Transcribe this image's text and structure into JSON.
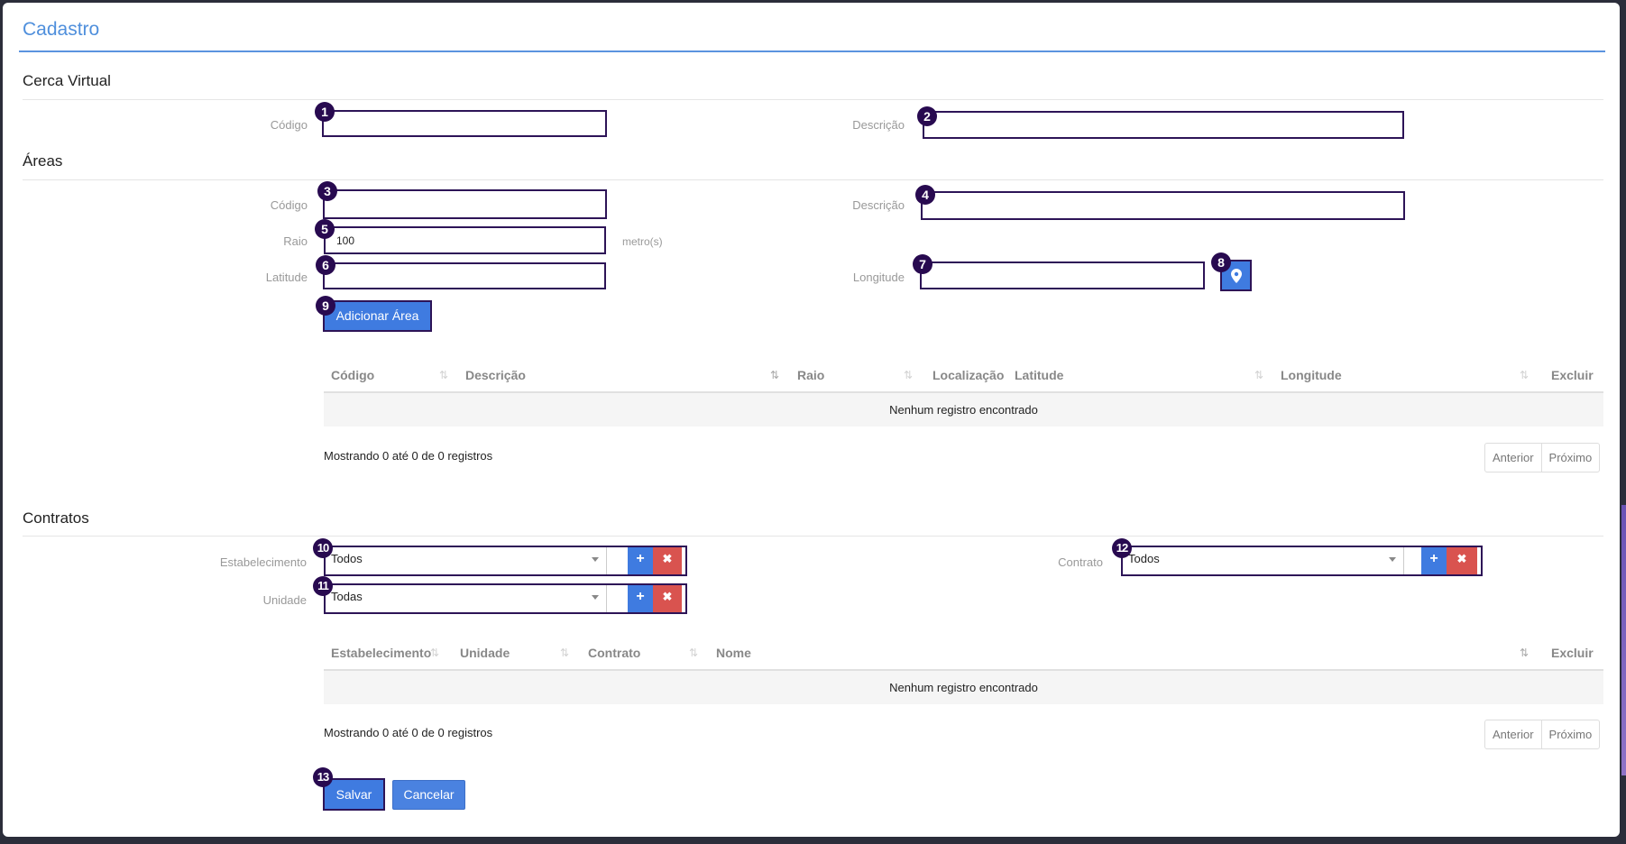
{
  "page": {
    "title": "Cadastro"
  },
  "cerca": {
    "section": "Cerca Virtual",
    "codigo_label": "Código",
    "descricao_label": "Descrição",
    "codigo_value": "",
    "descricao_value": ""
  },
  "areas": {
    "section": "Áreas",
    "codigo_label": "Código",
    "descricao_label": "Descrição",
    "raio_label": "Raio",
    "raio_value": "100",
    "raio_unit": "metro(s)",
    "latitude_label": "Latitude",
    "longitude_label": "Longitude",
    "add_button": "Adicionar Área",
    "table": {
      "columns": [
        "Código",
        "Descrição",
        "Raio",
        "Localização",
        "Latitude",
        "Longitude",
        "Excluir"
      ],
      "empty": "Nenhum registro encontrado",
      "info": "Mostrando 0 até 0 de 0 registros",
      "prev": "Anterior",
      "next": "Próximo"
    }
  },
  "contratos": {
    "section": "Contratos",
    "estabelecimento_label": "Estabelecimento",
    "estabelecimento_value": "Todos",
    "unidade_label": "Unidade",
    "unidade_value": "Todas",
    "contrato_label": "Contrato",
    "contrato_value": "Todos",
    "table": {
      "columns": [
        "Estabelecimento",
        "Unidade",
        "Contrato",
        "Nome",
        "Excluir"
      ],
      "empty": "Nenhum registro encontrado",
      "info": "Mostrando 0 até 0 de 0 registros",
      "prev": "Anterior",
      "next": "Próximo"
    }
  },
  "actions": {
    "save": "Salvar",
    "cancel": "Cancelar"
  },
  "badges": [
    "1",
    "2",
    "3",
    "4",
    "5",
    "6",
    "7",
    "8",
    "9",
    "10",
    "11",
    "12",
    "13"
  ],
  "icons": {
    "plus": "+",
    "close": "✖",
    "sort": "⇅",
    "location": "map-pin-icon"
  }
}
